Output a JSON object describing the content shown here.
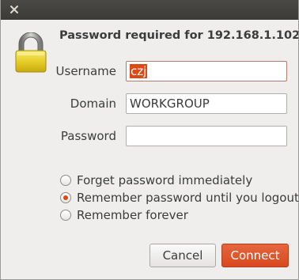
{
  "window": {
    "close_icon": "close-icon"
  },
  "dialog": {
    "icon": "lock-icon",
    "heading": "Password required for 192.168.1.102",
    "fields": {
      "username": {
        "label": "Username",
        "value": "czj"
      },
      "domain": {
        "label": "Domain",
        "value": "WORKGROUP"
      },
      "password": {
        "label": "Password",
        "value": ""
      }
    },
    "radio_options": [
      {
        "label": "Forget password immediately",
        "checked": false
      },
      {
        "label": "Remember password until you logout",
        "checked": true
      },
      {
        "label": "Remember forever",
        "checked": false
      }
    ],
    "buttons": {
      "cancel": "Cancel",
      "connect": "Connect"
    }
  },
  "colors": {
    "titlebar": "#3c3b37",
    "accent": "#dd4814",
    "background": "#efeeed"
  }
}
